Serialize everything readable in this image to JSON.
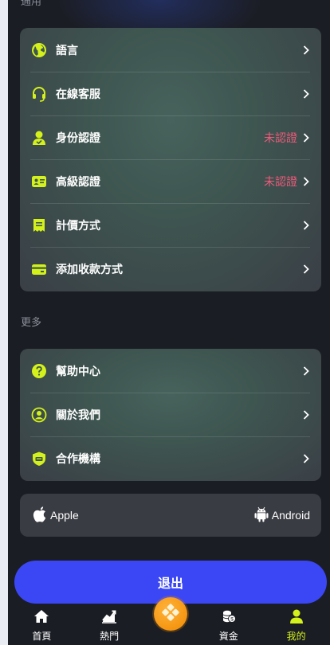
{
  "sections": {
    "general": {
      "label": "通用",
      "items": [
        {
          "label": "語言",
          "icon": "globe-icon",
          "status": ""
        },
        {
          "label": "在線客服",
          "icon": "headset-icon",
          "status": ""
        },
        {
          "label": "身份認證",
          "icon": "user-verify-icon",
          "status": "未認證"
        },
        {
          "label": "高級認證",
          "icon": "id-card-icon",
          "status": "未認證"
        },
        {
          "label": "計價方式",
          "icon": "receipt-icon",
          "status": ""
        },
        {
          "label": "添加收款方式",
          "icon": "payment-card-icon",
          "status": ""
        }
      ]
    },
    "more": {
      "label": "更多",
      "items": [
        {
          "label": "幫助中心",
          "icon": "help-icon"
        },
        {
          "label": "關於我們",
          "icon": "about-user-icon"
        },
        {
          "label": "合作機構",
          "icon": "partner-shield-icon"
        }
      ]
    }
  },
  "downloads": {
    "apple": "Apple",
    "android": "Android"
  },
  "logout_label": "退出",
  "tabs": [
    {
      "label": "首頁",
      "icon": "home-icon",
      "active": false
    },
    {
      "label": "熱門",
      "icon": "trending-chart-icon",
      "active": false
    },
    {
      "label": "資金",
      "icon": "coins-icon",
      "active": false
    },
    {
      "label": "我的",
      "icon": "profile-icon",
      "active": true
    }
  ],
  "colors": {
    "accent": "#d4f11b",
    "warning": "#ef5a7a",
    "primary": "#3b47f5",
    "center": "#f59a12"
  }
}
